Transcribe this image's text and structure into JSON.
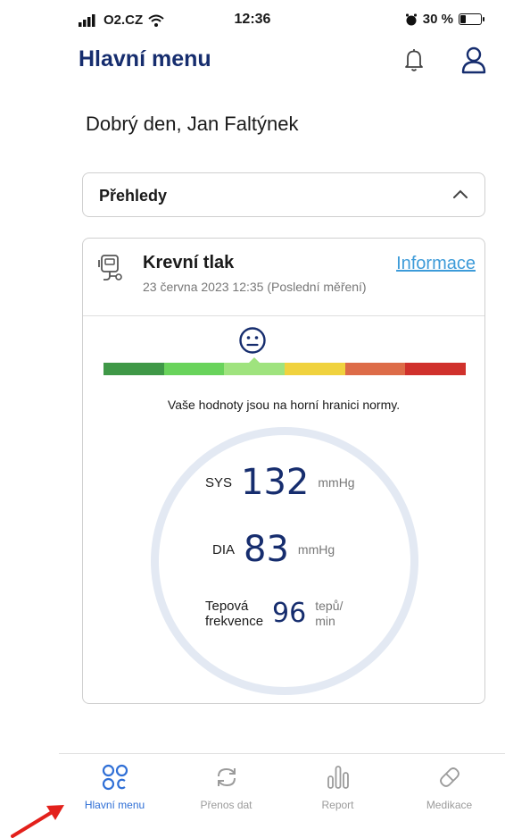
{
  "status_bar": {
    "carrier": "O2.CZ",
    "time": "12:36",
    "battery_text": "30 %",
    "battery_level": 0.3
  },
  "header": {
    "title": "Hlavní menu"
  },
  "greeting": "Dobrý den, Jan Faltýnek",
  "overview": {
    "label": "Přehledy"
  },
  "bp_card": {
    "title": "Krevní tlak",
    "date": "23 června 2023 12:35 (Poslední měření)",
    "info_link": "Informace",
    "message": "Vaše hodnoty jsou na horní hranici normy.",
    "scale_colors": [
      "#3f9847",
      "#69d35b",
      "#9fe37e",
      "#f0d23e",
      "#dd6c48",
      "#d0312c"
    ],
    "scale_active_index": 2,
    "sys": {
      "label": "SYS",
      "value": "132",
      "unit": "mmHg"
    },
    "dia": {
      "label": "DIA",
      "value": "83",
      "unit": "mmHg"
    },
    "hr": {
      "label_line1": "Tepová",
      "label_line2": "frekvence",
      "value": "96",
      "unit_line1": "tepů/",
      "unit_line2": "min"
    }
  },
  "tabbar": {
    "tabs": [
      {
        "label": "Hlavní menu",
        "icon": "grid-icon",
        "active": true
      },
      {
        "label": "Přenos dat",
        "icon": "sync-icon",
        "active": false
      },
      {
        "label": "Report",
        "icon": "bars-icon",
        "active": false
      },
      {
        "label": "Medikace",
        "icon": "pill-icon",
        "active": false
      }
    ]
  },
  "colors": {
    "brand": "#162d6e",
    "link": "#3d9bd9",
    "active_tab": "#2f6fd6",
    "arrow": "#e3201b"
  }
}
